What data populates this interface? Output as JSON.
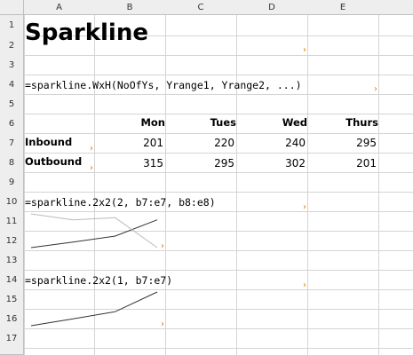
{
  "columns": [
    "A",
    "B",
    "C",
    "D",
    "E"
  ],
  "rows": [
    "1",
    "2",
    "3",
    "4",
    "5",
    "6",
    "7",
    "8",
    "9",
    "10",
    "11",
    "12",
    "13",
    "14",
    "15",
    "16",
    "17"
  ],
  "title": "Sparkline",
  "syntax": "=sparkline.WxH(NoOfYs, Yrange1, Yrange2, ...)",
  "table": {
    "headers": [
      "Mon",
      "Tues",
      "Wed",
      "Thurs"
    ],
    "rows": [
      {
        "label": "Inbound",
        "values": [
          "201",
          "220",
          "240",
          "295"
        ]
      },
      {
        "label": "Outbound",
        "values": [
          "315",
          "295",
          "302",
          "201"
        ]
      }
    ]
  },
  "formula1": "=sparkline.2x2(2, b7:e7, b8:e8)",
  "formula2": "=sparkline.2x2(1, b7:e7)",
  "marker": "›",
  "colors": {
    "grid": "#d4d4d4",
    "header_bg": "#eeeeee",
    "marker": "#e07b00",
    "line_inbound": "#333333",
    "line_outbound": "#bbbbbb"
  },
  "chart_data": [
    {
      "type": "line",
      "categories": [
        "Mon",
        "Tues",
        "Wed",
        "Thurs"
      ],
      "series": [
        {
          "values": [
            201,
            220,
            240,
            295
          ]
        },
        {
          "values": [
            315,
            295,
            302,
            201
          ]
        }
      ]
    },
    {
      "type": "line",
      "categories": [
        "Mon",
        "Tues",
        "Wed",
        "Thurs"
      ],
      "series": [
        {
          "values": [
            201,
            220,
            240,
            295
          ]
        }
      ]
    }
  ]
}
